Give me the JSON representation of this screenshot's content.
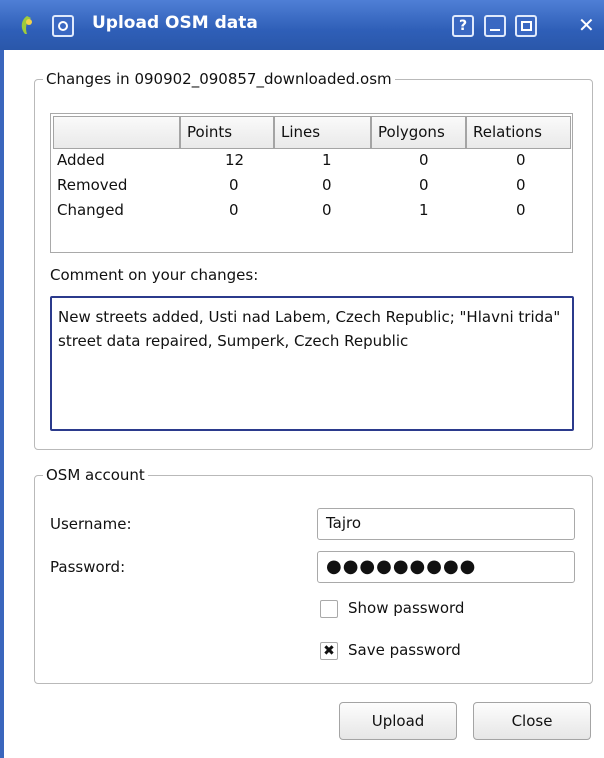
{
  "window": {
    "title": "Upload OSM data",
    "help_btn": "?"
  },
  "changes": {
    "legend": "Changes in 090902_090857_downloaded.osm",
    "columns": [
      "",
      "Points",
      "Lines",
      "Polygons",
      "Relations"
    ],
    "rows": [
      {
        "label": "Added",
        "values": [
          "12",
          "1",
          "0",
          "0"
        ]
      },
      {
        "label": "Removed",
        "values": [
          "0",
          "0",
          "0",
          "0"
        ]
      },
      {
        "label": "Changed",
        "values": [
          "0",
          "0",
          "1",
          "0"
        ]
      }
    ],
    "comment_label": "Comment on your changes:",
    "comment_text": "New streets added, Usti nad Labem, Czech Republic; \"Hlavni trida\" street data repaired, Sumperk, Czech Republic"
  },
  "account": {
    "legend": "OSM account",
    "username_label": "Username:",
    "username_value": "Tajro",
    "password_label": "Password:",
    "password_value": "●●●●●●●●●",
    "show_password_label": "Show password",
    "show_password_checked": false,
    "save_password_label": "Save password",
    "save_password_checked": true,
    "check_mark": "✖"
  },
  "buttons": {
    "upload": "Upload",
    "close": "Close"
  },
  "colors": {
    "titlebar": "#2f5fb8",
    "comment_border": "#2b3a8c"
  }
}
